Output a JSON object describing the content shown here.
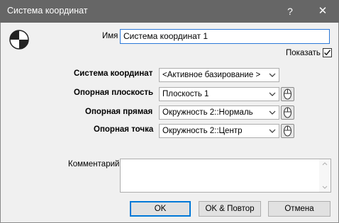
{
  "window": {
    "title": "Система координат",
    "help_label": "?",
    "close_label": "✕"
  },
  "form": {
    "name_label": "Имя",
    "name_value": "Система координат 1",
    "show_label": "Показать",
    "show_checked": true,
    "coord_system_label": "Система координат",
    "coord_system_value": "<Активное базирование >",
    "ref_plane_label": "Опорная плоскость",
    "ref_plane_value": "Плоскость 1",
    "ref_line_label": "Опорная прямая",
    "ref_line_value": "Окружность 2::Нормаль",
    "ref_point_label": "Опорная точка",
    "ref_point_value": "Окружность 2::Центр",
    "comment_label": "Комментарий",
    "comment_value": ""
  },
  "buttons": {
    "ok": "OK",
    "ok_repeat": "OK & Повтор",
    "cancel": "Отмена"
  },
  "icons": {
    "app": "coordinate-system-icon",
    "pick": "mouse-pick-icon",
    "dropdown": "chevron-down-icon",
    "check": "checkmark-icon"
  },
  "colors": {
    "titlebar": "#666666",
    "client": "#f0f0f0",
    "focus_border": "#2b79d8",
    "default_button_border": "#0078d7"
  }
}
